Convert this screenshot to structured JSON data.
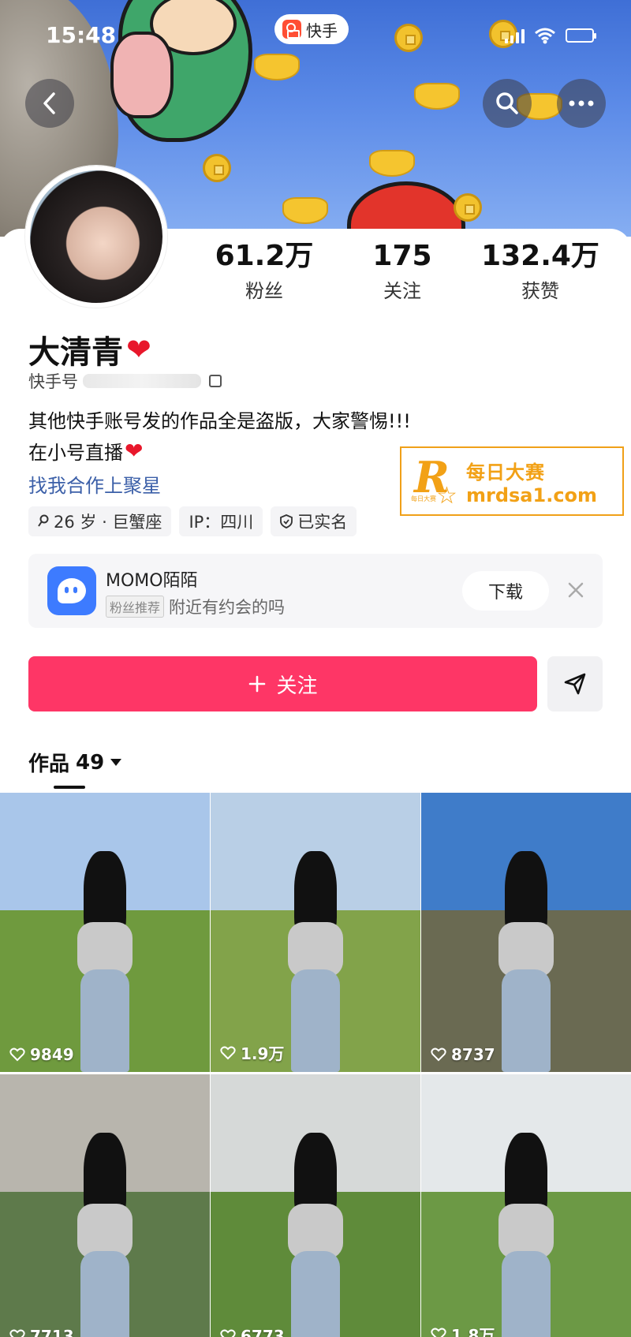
{
  "status_bar": {
    "time": "15:48",
    "app_badge": "快手"
  },
  "profile": {
    "stats": [
      {
        "value": "61.2万",
        "label": "粉丝"
      },
      {
        "value": "175",
        "label": "关注"
      },
      {
        "value": "132.4万",
        "label": "获赞"
      }
    ],
    "name": "大清青",
    "kuaishou_id_label": "快手号",
    "bio_line1": "其他快手账号发的作品全是盗版，大家警惕!!!",
    "bio_line2": "在小号直播",
    "bio_link": "找我合作上聚星",
    "tags": [
      "26 岁 · 巨蟹座",
      "IP：四川",
      "已实名"
    ]
  },
  "watermark": {
    "line1": "每日大赛",
    "line2": "mrdsa1.com",
    "small": "每日大赛"
  },
  "ad": {
    "title": "MOMO陌陌",
    "chip": "粉丝推荐",
    "subtitle": "附近有约会的吗",
    "button": "下载"
  },
  "actions": {
    "follow_label": "关注"
  },
  "works": {
    "tab_label": "作品",
    "count": "49"
  },
  "grid_items": [
    {
      "likes": "9849",
      "sky": "#a9c6ea",
      "ground": "#6f9a3e"
    },
    {
      "likes": "1.9万",
      "sky": "#b9cfe6",
      "ground": "#82a34a"
    },
    {
      "likes": "8737",
      "sky": "#3f7cc9",
      "ground": "#6a6a52"
    },
    {
      "likes": "7713",
      "sky": "#b8b5ad",
      "ground": "#5e7a4b"
    },
    {
      "likes": "6773",
      "sky": "#d6d9d8",
      "ground": "#5f8b3a"
    },
    {
      "likes": "1.8万",
      "sky": "#e4e8ea",
      "ground": "#6c9945"
    }
  ],
  "colors": {
    "accent": "#fe3666",
    "link": "#3b5fa8",
    "watermark": "#f2a116"
  },
  "icons": [
    "back-icon",
    "search-icon",
    "more-icon",
    "copy-icon",
    "location-icon",
    "shield-icon",
    "close-icon",
    "plus-icon",
    "send-icon",
    "heart-icon"
  ]
}
